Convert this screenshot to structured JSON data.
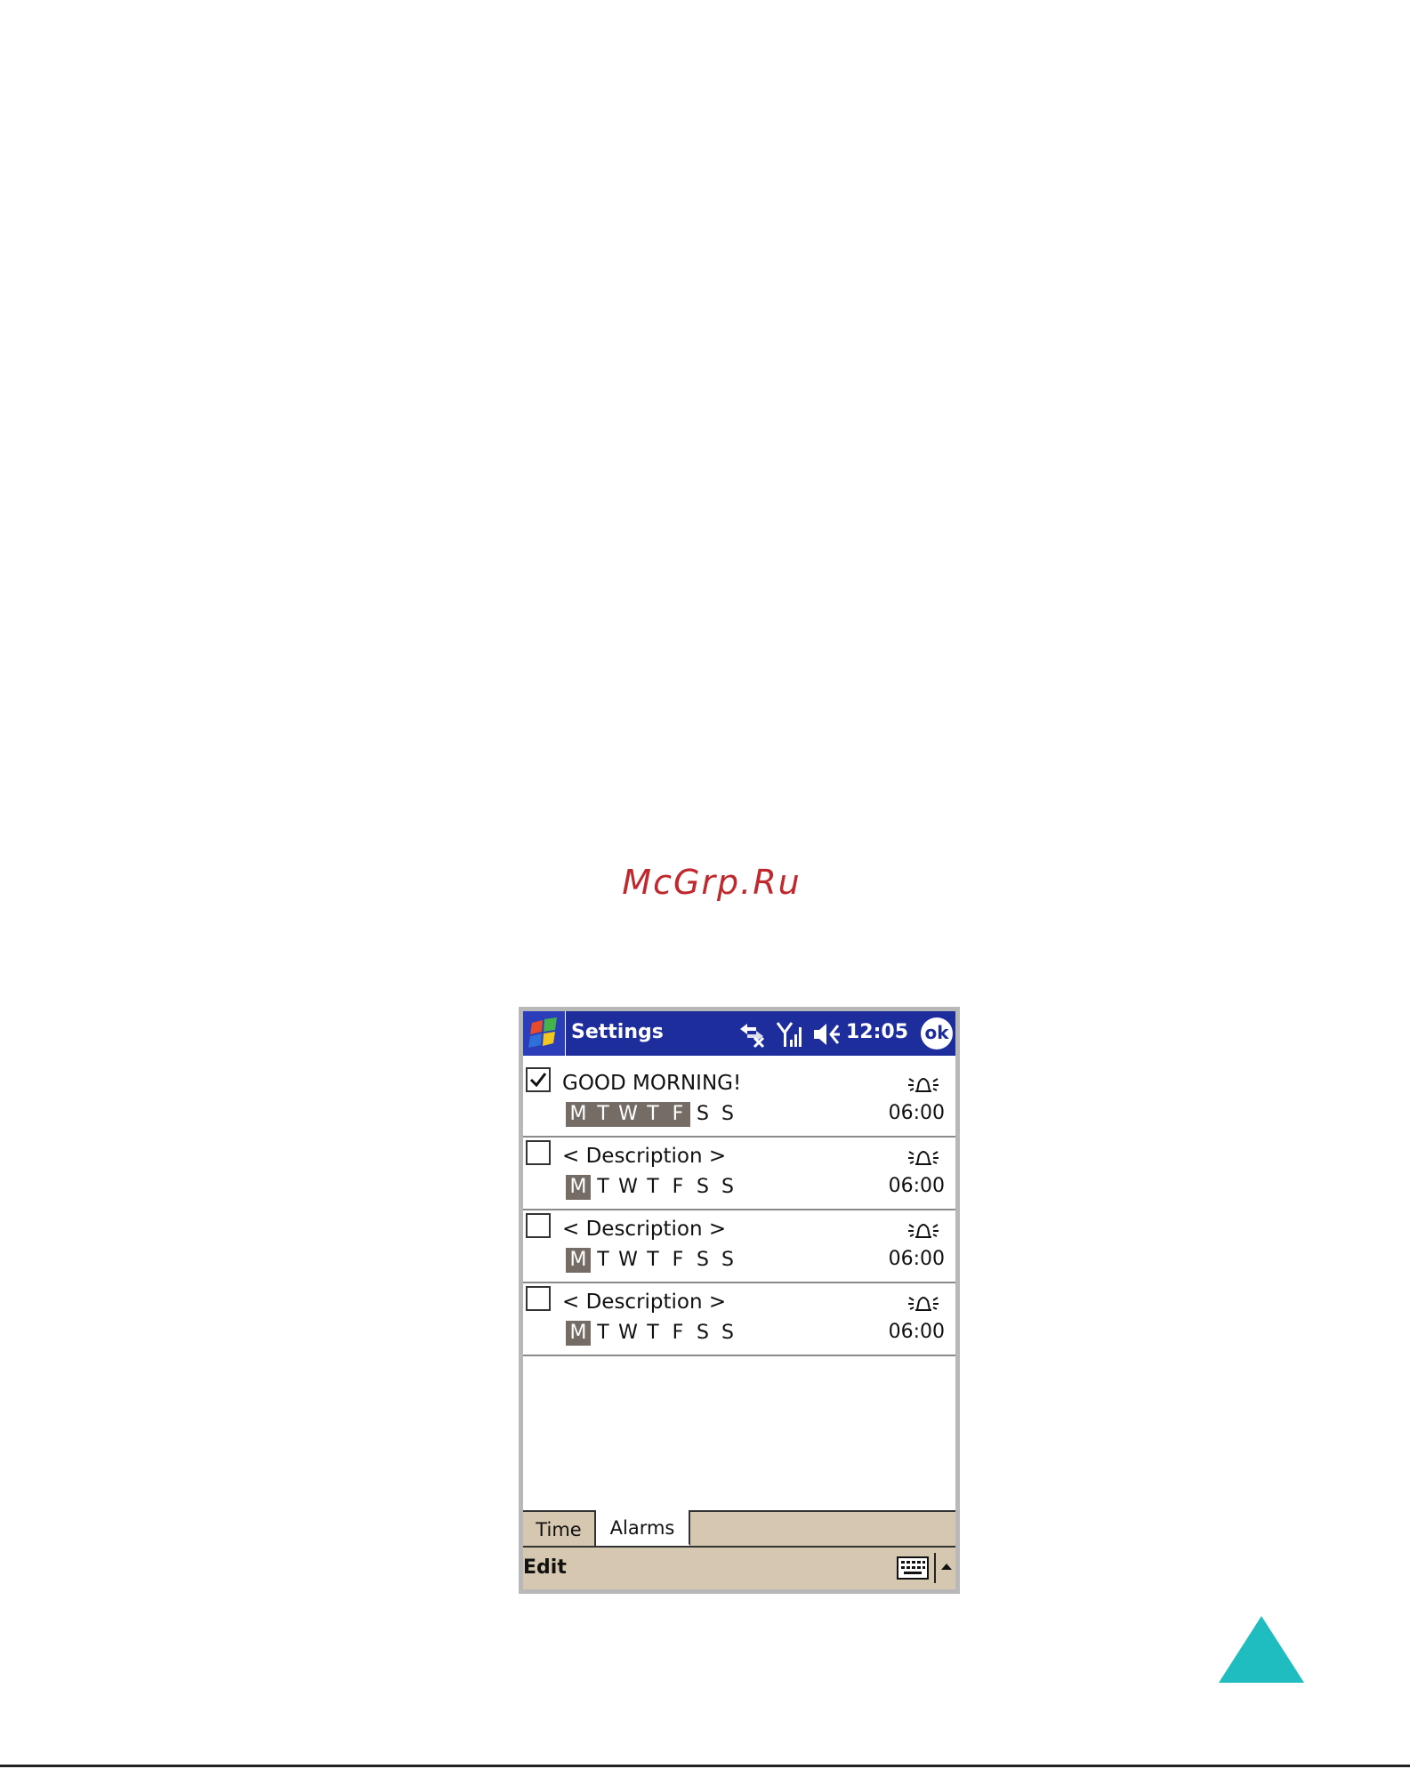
{
  "watermark": "McGrp.Ru",
  "titlebar": {
    "title": "Settings",
    "clock": "12:05",
    "ok_label": "ok",
    "color": "#1e2d9c"
  },
  "alarms": [
    {
      "description": "GOOD MORNING!",
      "checked": true,
      "time": "06:00",
      "days_active": [
        true,
        true,
        true,
        true,
        true,
        false,
        false
      ]
    },
    {
      "description": "< Description >",
      "checked": false,
      "time": "06:00",
      "days_active": [
        true,
        false,
        false,
        false,
        false,
        false,
        false
      ]
    },
    {
      "description": "< Description >",
      "checked": false,
      "time": "06:00",
      "days_active": [
        true,
        false,
        false,
        false,
        false,
        false,
        false
      ]
    },
    {
      "description": "< Description >",
      "checked": false,
      "time": "06:00",
      "days_active": [
        true,
        false,
        false,
        false,
        false,
        false,
        false
      ]
    }
  ],
  "day_letters": [
    "M",
    "T",
    "W",
    "T",
    "F",
    "S",
    "S"
  ],
  "tabs": [
    {
      "label": "Time",
      "active": false
    },
    {
      "label": "Alarms",
      "active": true
    }
  ],
  "menubar": {
    "edit_label": "Edit"
  },
  "icons": {
    "start": "windows-flag-icon",
    "sync": "sync-disconnected-icon",
    "signal": "signal-strength-icon",
    "volume": "speaker-muted-icon",
    "alarm": "alarm-bell-icon",
    "keyboard": "keyboard-icon",
    "menu_arrow": "triangle-up-icon",
    "nav": "triangle-up-icon"
  },
  "colors": {
    "day_highlight": "#766c66",
    "chrome": "#d6c8b0",
    "watermark": "#c0282d",
    "nav_triangle": "#1fbcc0"
  }
}
